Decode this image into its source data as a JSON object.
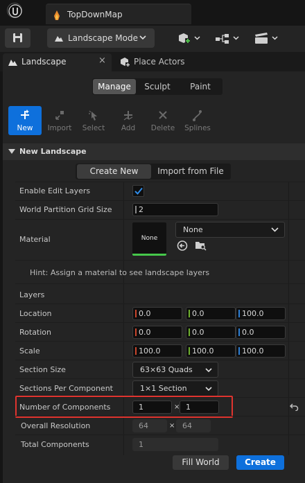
{
  "document": {
    "tab_title": "TopDownMap"
  },
  "toolbar": {
    "mode_label": "Landscape Mode"
  },
  "panel_tabs": [
    {
      "label": "Landscape",
      "close": "×"
    },
    {
      "label": "Place Actors"
    }
  ],
  "mode_tabs": [
    "Manage",
    "Sculpt",
    "Paint"
  ],
  "tools": [
    {
      "label": "New",
      "icon": "plus-icon",
      "active": true
    },
    {
      "label": "Import",
      "icon": "import-icon",
      "active": false
    },
    {
      "label": "Select",
      "icon": "select-icon",
      "active": false
    },
    {
      "label": "Add",
      "icon": "plus-icon",
      "active": false
    },
    {
      "label": "Delete",
      "icon": "delete-icon",
      "active": false
    },
    {
      "label": "Splines",
      "icon": "spline-icon",
      "active": false
    }
  ],
  "section": {
    "title": "New Landscape"
  },
  "create_toggle": {
    "create": "Create New",
    "import": "Import from File"
  },
  "rows": {
    "edit_layers": {
      "label": "Enable Edit Layers",
      "checked": true
    },
    "grid_size": {
      "label": "World Partition Grid Size",
      "value": "2"
    },
    "material": {
      "label": "Material",
      "thumb": "None",
      "value": "None"
    },
    "hint": "Hint: Assign a material to see landscape layers",
    "layers": {
      "label": "Layers"
    },
    "location": {
      "label": "Location",
      "x": "0.0",
      "y": "0.0",
      "z": "100.0"
    },
    "rotation": {
      "label": "Rotation",
      "x": "0.0",
      "y": "0.0",
      "z": "0.0"
    },
    "scale": {
      "label": "Scale",
      "x": "100.0",
      "y": "100.0",
      "z": "100.0"
    },
    "section_size": {
      "label": "Section Size",
      "value": "63×63 Quads"
    },
    "sections_per_component": {
      "label": "Sections Per Component",
      "value": "1×1 Section"
    },
    "num_components": {
      "label": "Number of Components",
      "x": "1",
      "y": "1",
      "times": "×"
    },
    "overall_resolution": {
      "label": "Overall Resolution",
      "x": "64",
      "y": "64",
      "times": "×"
    },
    "total_components": {
      "label": "Total Components",
      "value": "1"
    }
  },
  "buttons": {
    "fill_world": "Fill World",
    "create": "Create"
  },
  "colors": {
    "accent": "#0e70dc",
    "highlight": "#e0342f",
    "axis_x": "#c9452b",
    "axis_y": "#6fb02d",
    "axis_z": "#2c7fd6"
  }
}
